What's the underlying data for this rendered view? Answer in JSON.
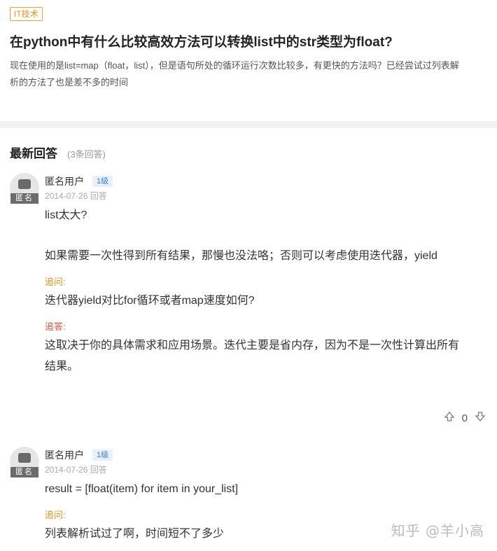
{
  "question": {
    "tag": "IT技术",
    "title": "在python中有什么比较高效方法可以转换list中的str类型为float?",
    "description": "现在使用的是list=map（float，list），但是语句所处的循环运行次数比较多，有更快的方法吗？已经尝试过列表解析的方法了也是差不多的时间"
  },
  "answers_header": {
    "title": "最新回答",
    "count": "(3条回答)"
  },
  "answers": [
    {
      "avatar_badge": "匿名",
      "user": "匿名用户",
      "level": "1级",
      "meta": "2014-07-26 回答",
      "lines": [
        "list太大?",
        "如果需要一次性得到所有结果，那慢也没法咯；否则可以考虑使用迭代器，yield"
      ],
      "ask_label": "追问:",
      "ask_text": "迭代器yield对比for循环或者map速度如何?",
      "reply_label": "追答:",
      "reply_text_1": "这取决于你的具体需求和应用场景。迭代主要是省内存，因为不是一次性计算出所有",
      "reply_text_2": "结果。",
      "votes": "0"
    },
    {
      "avatar_badge": "匿名",
      "user": "匿名用户",
      "level": "1级",
      "meta": "2014-07-26 回答",
      "lines": [
        "result = [float(item) for item in your_list]"
      ],
      "ask_label": "追问:",
      "ask_text": "列表解析试过了啊，时间短不了多少"
    }
  ],
  "watermark": "知乎 @羊小高",
  "icons": {
    "upvote": "arrow-up-outline-icon",
    "downvote": "arrow-down-outline-icon"
  }
}
